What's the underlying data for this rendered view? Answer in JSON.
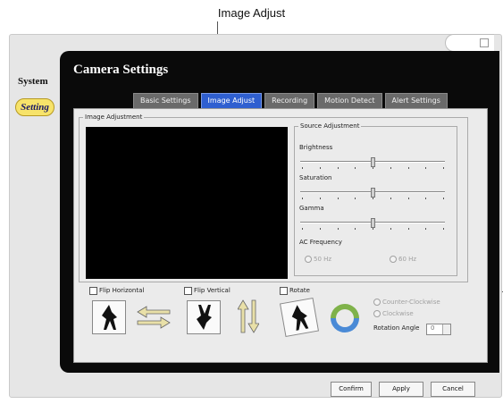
{
  "callout": {
    "title": "Image Adjust"
  },
  "sidebar": {
    "title": "System",
    "setting_label": "Setting"
  },
  "panel": {
    "title": "Camera Settings",
    "tabs": [
      {
        "label": "Basic Settings"
      },
      {
        "label": "Image Adjust",
        "active": true
      },
      {
        "label": "Recording"
      },
      {
        "label": "Motion Detect"
      },
      {
        "label": "Alert Settings"
      }
    ]
  },
  "image_adjustment": {
    "group_label": "Image Adjustment",
    "source_adjustment": {
      "group_label": "Source Adjustment",
      "brightness_label": "Brightness",
      "saturation_label": "Saturation",
      "gamma_label": "Gamma",
      "ac_frequency_label": "AC Frequency",
      "option_50": "50 Hz",
      "option_60": "60 Hz",
      "brightness_level": 0.5,
      "saturation_level": 0.5,
      "gamma_level": 0.5
    },
    "flip_horizontal_label": "Flip Horizontal",
    "flip_vertical_label": "Flip Vertical",
    "rotate_label": "Rotate",
    "counter_clockwise_label": "Counter-Clockwise",
    "clockwise_label": "Clockwise",
    "rotation_angle_label": "Rotation Angle",
    "rotation_angle_value": "0"
  },
  "footer": {
    "confirm": "Confirm",
    "apply": "Apply",
    "cancel": "Cancel"
  },
  "colors": {
    "active_tab": "#2f5fd0",
    "panel_bg": "#0a0a0a",
    "setting_badge": "#f7e36a"
  }
}
